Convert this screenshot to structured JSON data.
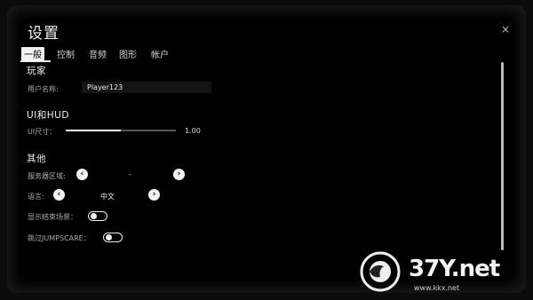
{
  "window": {
    "title": "设置",
    "close_glyph": "×"
  },
  "tabs": [
    {
      "label": "一般",
      "active": true
    },
    {
      "label": "控制"
    },
    {
      "label": "音频"
    },
    {
      "label": "图形"
    },
    {
      "label": "帐户"
    }
  ],
  "player": {
    "section": "玩家",
    "username_label": "用户名称:",
    "username_value": "Player123"
  },
  "ui_hud": {
    "section": "UI和HUD",
    "size_label": "UI尺寸：",
    "size_value": "1.00",
    "size_fraction": 0.5
  },
  "other": {
    "section": "其他",
    "server_label": "服务器区域:",
    "server_value": "-",
    "language_label": "语言:",
    "language_value": "中文",
    "show_end_scene_label": "显示结束场景：",
    "show_end_scene_on": false,
    "skip_jumpscare_label": "跳过JUMPSCARE：",
    "skip_jumpscare_on": false
  },
  "icons": {
    "prev": "chevron-left-icon",
    "next": "chevron-right-icon",
    "close": "close-icon"
  },
  "watermark": {
    "text": "37Y.net",
    "sub": "www.kkx.net"
  }
}
